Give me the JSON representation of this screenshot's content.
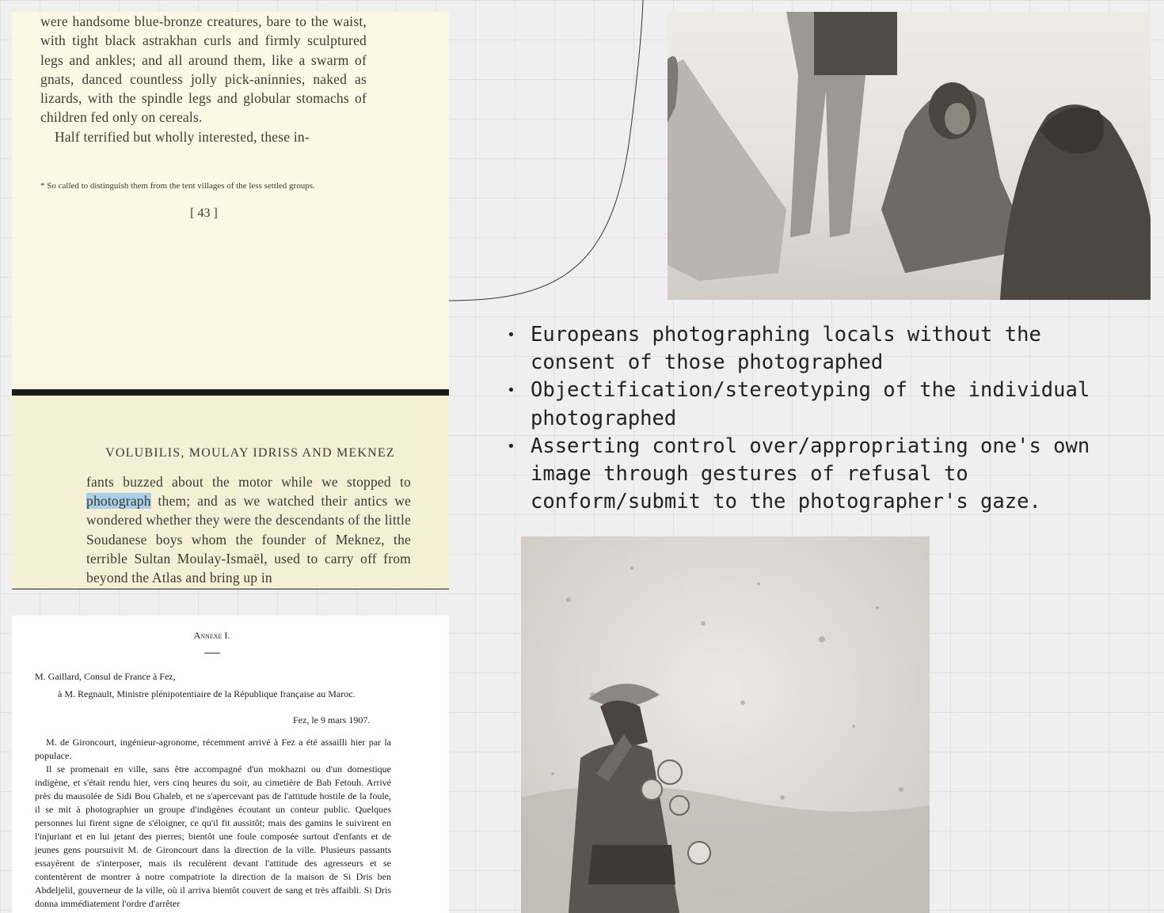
{
  "book_page_top": {
    "paragraph_1": "were handsome blue-bronze creatures, bare to the waist, with tight black astrakhan curls and firmly sculptured legs and ankles; and all around them, like a swarm of gnats, danced countless jolly pick-aninnies, naked as lizards, with the spindle legs and globular stomachs of children fed only on cereals.",
    "paragraph_2": "Half terrified but wholly interested, these in-",
    "footnote": "* So called to distinguish them from the tent villages of the less settled groups.",
    "page_number": "[ 43 ]"
  },
  "book_page_bottom": {
    "running_head": "VOLUBILIS, MOULAY IDRISS AND MEKNEZ",
    "text_before": "fants buzzed about the motor while we stopped to ",
    "highlighted": "photograph",
    "text_after": " them; and as we watched their antics we wondered whether they were the descendants of the little Soudanese boys whom the founder of Meknez, the terrible Sultan Moulay-Ismaël, used to carry off from beyond the Atlas and bring up in"
  },
  "annex_document": {
    "title": "Annexe I.",
    "from_line": "M. Gaillard, Consul de France à Fez,",
    "to_line": "à M. Regnault, Ministre plénipotentiaire de la République française au Maroc.",
    "date": "Fez, le 9 mars 1907.",
    "paragraph_1": "M. de Gironcourt, ingénieur-agronome, récemment arrivé à Fez a été assailli hier par la populace.",
    "paragraph_2": "Il se promenait en ville, sans être accompagné d'un mokhazni ou d'un domestique indigène, et s'était rendu hier, vers cinq heures du soir, au cimetière de Bab Fetouh. Arrivé près du mausolée de Sidi Bou Ghaleb, et ne s'apercevant pas de l'attitude hostile de la foule, il se mit à photographier un groupe d'indigènes écoutant un conteur public. Quelques personnes lui firent signe de s'éloigner, ce qu'il fit aussitôt; mais des gamins le suivirent en l'injuriant et en lui jetant des pierres; bientôt une foule composée surtout d'enfants et de jeunes gens poursuivit M. de Gironcourt dans la direction de la ville. Plusieurs passants essayèrent de s'interposer, mais ils reculèrent devant l'attitude des agresseurs et se contentèrent de montrer à notre compatriote la direction de la maison de Si Dris ben Abdeljelil, gouverneur de la ville, où il arriva bientôt couvert de sang et très affaibli. Si Dris donna immédiatement l'ordre d'arrêter"
  },
  "bullets": [
    "Europeans photographing locals without the consent of those photographed",
    "Objectification/stereotyping of the individual photographed",
    "Asserting control over/appropriating one's own image through gestures of refusal to conform/submit to the photographer's gaze."
  ]
}
